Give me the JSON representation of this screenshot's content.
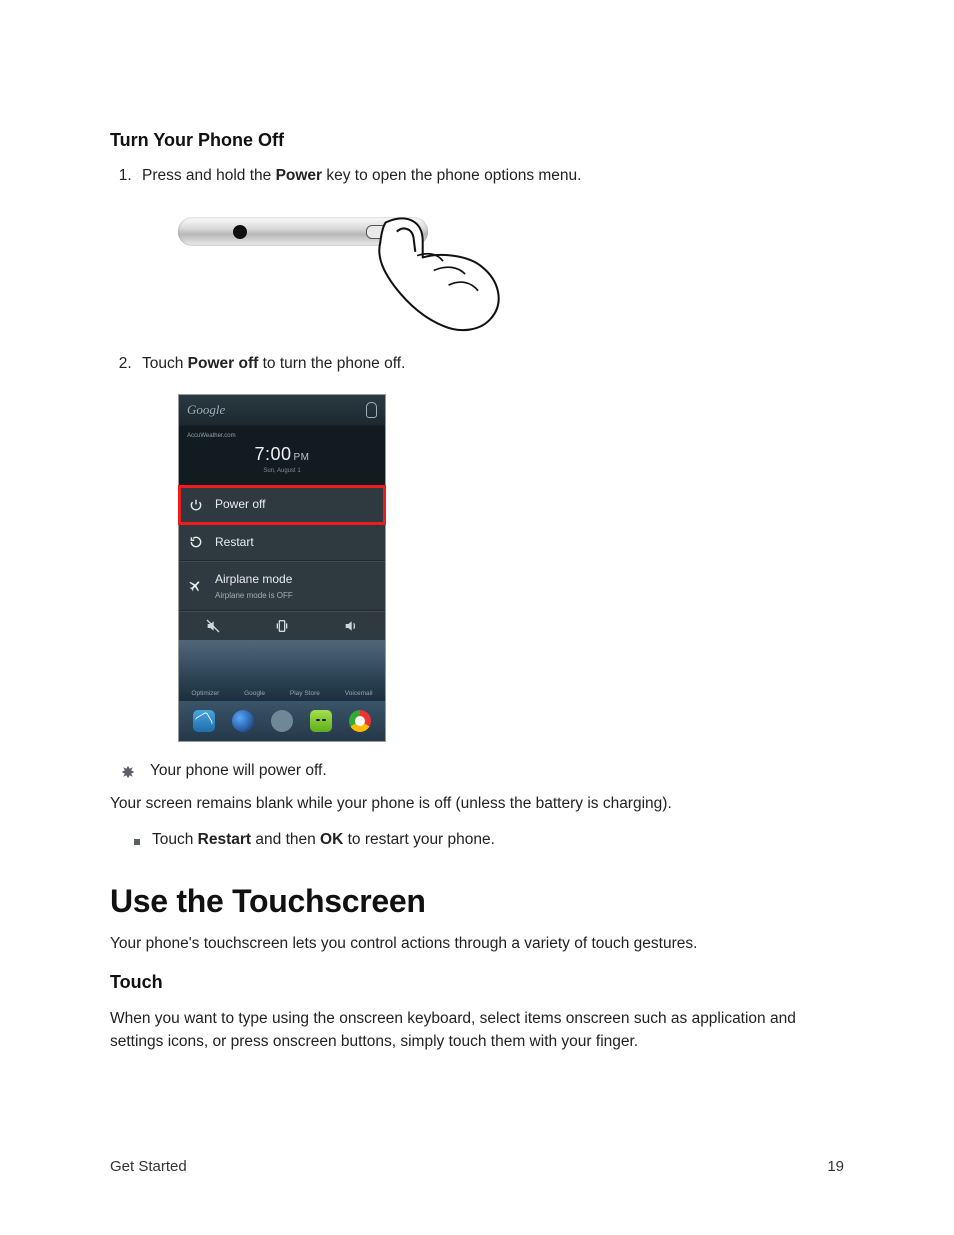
{
  "section1_title": "Turn Your Phone Off",
  "step1_a": "Press and hold the ",
  "step1_b": "Power",
  "step1_c": " key to open the phone options menu.",
  "step2_a": "Touch ",
  "step2_b": "Power off",
  "step2_c": " to turn the phone off.",
  "shot": {
    "google": "Google",
    "provider": "AccuWeather.com",
    "time": "7:00",
    "pm": "PM",
    "date": "Sun, August 1",
    "poweroff": "Power off",
    "restart": "Restart",
    "airplane": "Airplane mode",
    "airplane_sub": "Airplane mode is OFF",
    "wall": {
      "a": "Optimizer",
      "b": "Google",
      "c": "Play Store",
      "d": "Voicemail"
    }
  },
  "note1": "Your phone will power off.",
  "para1": "Your screen remains blank while your phone is off (unless the battery is charging).",
  "bullet_a": "Touch ",
  "bullet_b": "Restart",
  "bullet_c": " and then ",
  "bullet_d": "OK",
  "bullet_e": " to restart your phone.",
  "h1": "Use the Touchscreen",
  "para2": "Your phone's touchscreen lets you control actions through a variety of touch gestures.",
  "section2_title": "Touch",
  "para3": "When you want to type using the onscreen keyboard, select items onscreen such as application and settings icons, or press onscreen buttons, simply touch them with your finger.",
  "footer_left": "Get Started",
  "footer_right": "19"
}
